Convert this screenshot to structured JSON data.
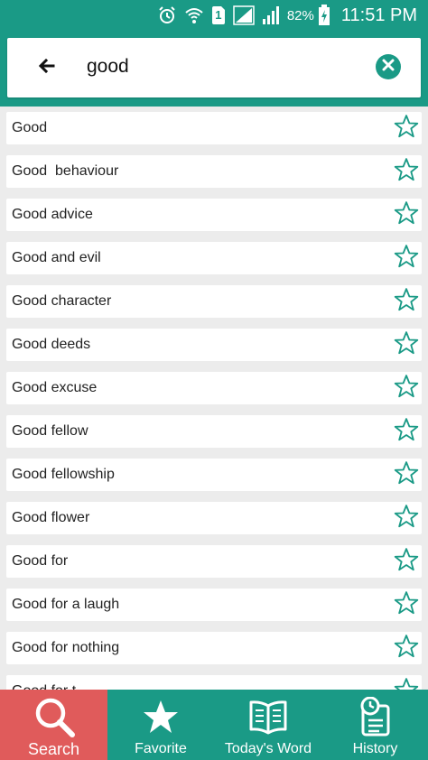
{
  "status_bar": {
    "battery_percent": "82%",
    "time": "11:51 PM",
    "sim_number": "1",
    "icons": [
      "alarm-icon",
      "wifi-icon",
      "sim-icon",
      "signal-icon",
      "signal-icon",
      "battery-charging-icon"
    ]
  },
  "search": {
    "query": "good",
    "back_icon": "arrow-left-icon",
    "clear_icon": "close-circle-icon"
  },
  "results": [
    "Good",
    "Good  behaviour",
    "Good advice",
    "Good and evil",
    "Good character",
    "Good deeds",
    "Good excuse",
    "Good fellow",
    "Good fellowship",
    "Good flower",
    "Good for",
    "Good for a laugh",
    "Good for nothing",
    "Good for t..."
  ],
  "bottom_nav": {
    "tabs": [
      {
        "label": "Search",
        "icon": "search-icon",
        "active": true
      },
      {
        "label": "Favorite",
        "icon": "star-icon",
        "active": false
      },
      {
        "label": "Today's Word",
        "icon": "book-icon",
        "active": false
      },
      {
        "label": "History",
        "icon": "history-icon",
        "active": false
      }
    ]
  },
  "colors": {
    "primary": "#1a9a86",
    "active_tab": "#e05b5b",
    "star_outline": "#1a9a86"
  }
}
